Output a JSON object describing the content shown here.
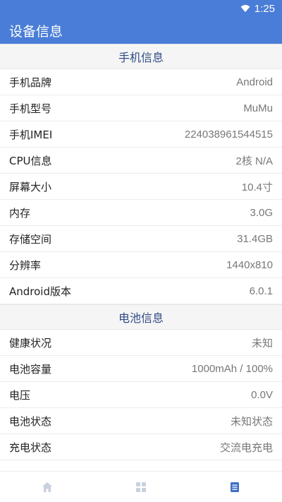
{
  "status_bar": {
    "time": "1:25"
  },
  "app_bar": {
    "title": "设备信息"
  },
  "phone_section": {
    "title": "手机信息",
    "rows": [
      {
        "label": "手机品牌",
        "value": "Android"
      },
      {
        "label": "手机型号",
        "value": "MuMu"
      },
      {
        "label": "手机IMEI",
        "value": "224038961544515"
      },
      {
        "label": "CPU信息",
        "value": "2核 N/A"
      },
      {
        "label": "屏幕大小",
        "value": "10.4寸"
      },
      {
        "label": "内存",
        "value": "3.0G"
      },
      {
        "label": "存储空间",
        "value": "31.4GB"
      },
      {
        "label": "分辨率",
        "value": "1440x810"
      },
      {
        "label": "Android版本",
        "value": "6.0.1"
      }
    ]
  },
  "battery_section": {
    "title": "电池信息",
    "rows": [
      {
        "label": "健康状况",
        "value": "未知"
      },
      {
        "label": "电池容量",
        "value": "1000mAh / 100%"
      },
      {
        "label": "电压",
        "value": "0.0V"
      },
      {
        "label": "电池状态",
        "value": "未知状态"
      },
      {
        "label": "充电状态",
        "value": "交流电充电"
      }
    ]
  },
  "bottom_nav": {
    "items": [
      {
        "icon": "home-icon"
      },
      {
        "icon": "grid-icon"
      },
      {
        "icon": "document-icon",
        "active": true
      }
    ]
  },
  "colors": {
    "primary": "#4a7dd7",
    "section_title": "#2f4b85",
    "nav_inactive": "#c9d1de",
    "nav_active": "#3f6fc7"
  }
}
